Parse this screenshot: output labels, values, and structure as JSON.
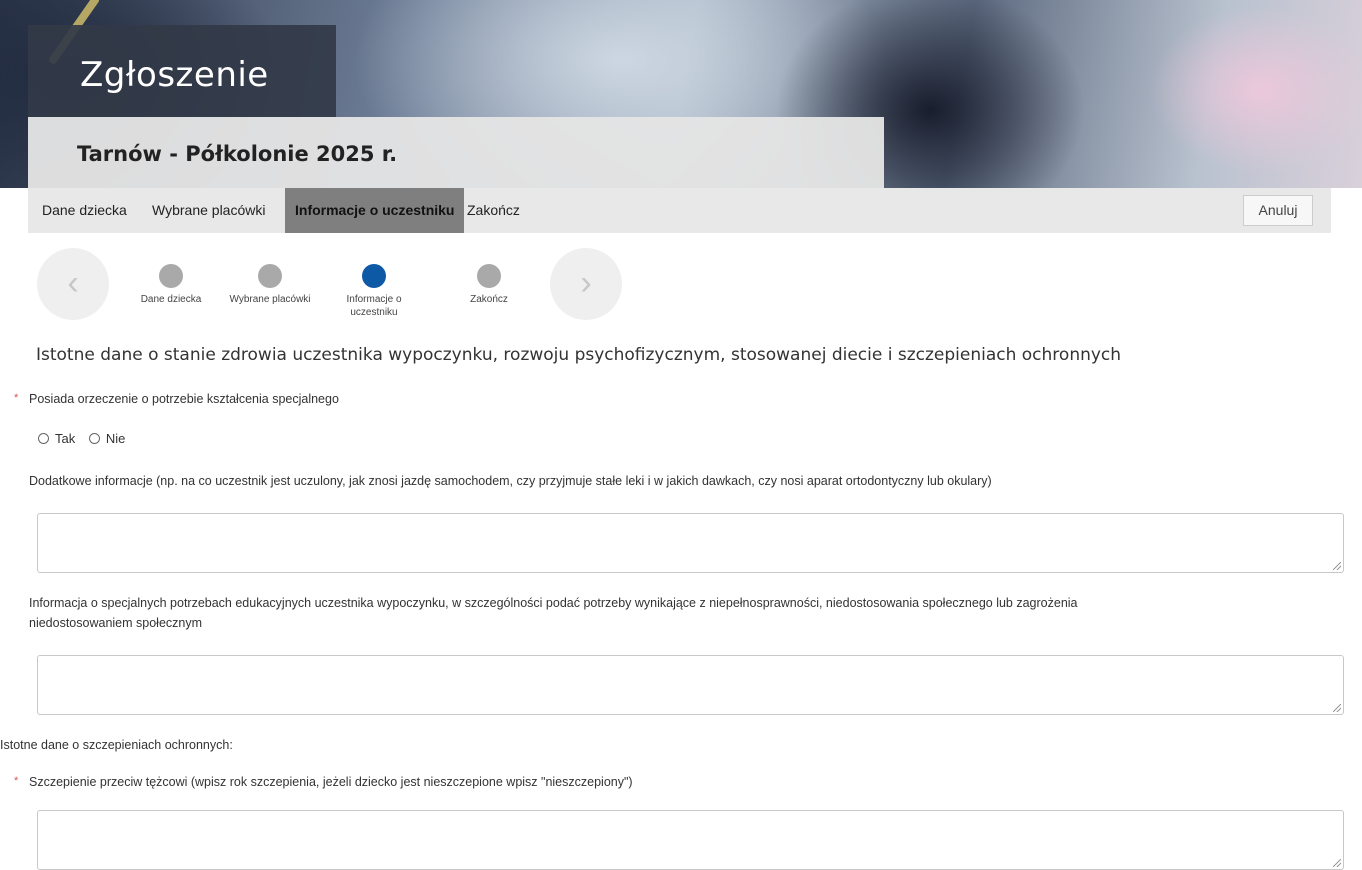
{
  "header": {
    "title": "Zgłoszenie",
    "subtitle": "Tarnów - Półkolonie 2025 r."
  },
  "nav": {
    "tabs": [
      {
        "label": "Dane dziecka",
        "active": false
      },
      {
        "label": "Wybrane placówki",
        "active": false
      },
      {
        "label": "Informacje o uczestniku",
        "active": true
      },
      {
        "label": "Zakończ",
        "active": false
      }
    ],
    "cancel_label": "Anuluj"
  },
  "stepper": {
    "prev_icon": "chevron-left-icon",
    "next_icon": "chevron-right-icon",
    "steps": [
      {
        "label": "Dane dziecka"
      },
      {
        "label": "Wybrane placówki"
      },
      {
        "label_line1": "Informacje o",
        "label_line2": "uczestniku",
        "active": true
      },
      {
        "label": "Zakończ"
      }
    ]
  },
  "form": {
    "section_title": "Istotne dane o stanie zdrowia uczestnika wypoczynku, rozwoju psychofizycznym, stosowanej diecie i szczepieniach ochronnych",
    "required_mark": "*",
    "special_ed_label": "Posiada orzeczenie o potrzebie kształcenia specjalnego",
    "options": [
      "Tak",
      "Nie"
    ],
    "additional_info_label": "Dodatkowe informacje (np. na co uczestnik jest uczulony, jak znosi jazdę samochodem, czy przyjmuje stałe leki i w jakich dawkach, czy nosi aparat ortodontyczny lub okulary)",
    "additional_info_value": "",
    "edu_needs_label_line1": "Informacja o specjalnych potrzebach edukacyjnych uczestnika wypoczynku, w szczególności podać potrzeby wynikające z niepełnosprawności, niedostosowania społecznego lub zagrożenia",
    "edu_needs_label_line2": "niedostosowaniem społecznym",
    "edu_needs_value": "",
    "vaccination_heading": "Istotne dane o szczepieniach ochronnych:",
    "tetanus_label": "Szczepienie przeciw tężcowi (wpisz rok szczepienia, jeżeli dziecko jest nieszczepione wpisz \"nieszczepiony\")",
    "tetanus_value": ""
  }
}
